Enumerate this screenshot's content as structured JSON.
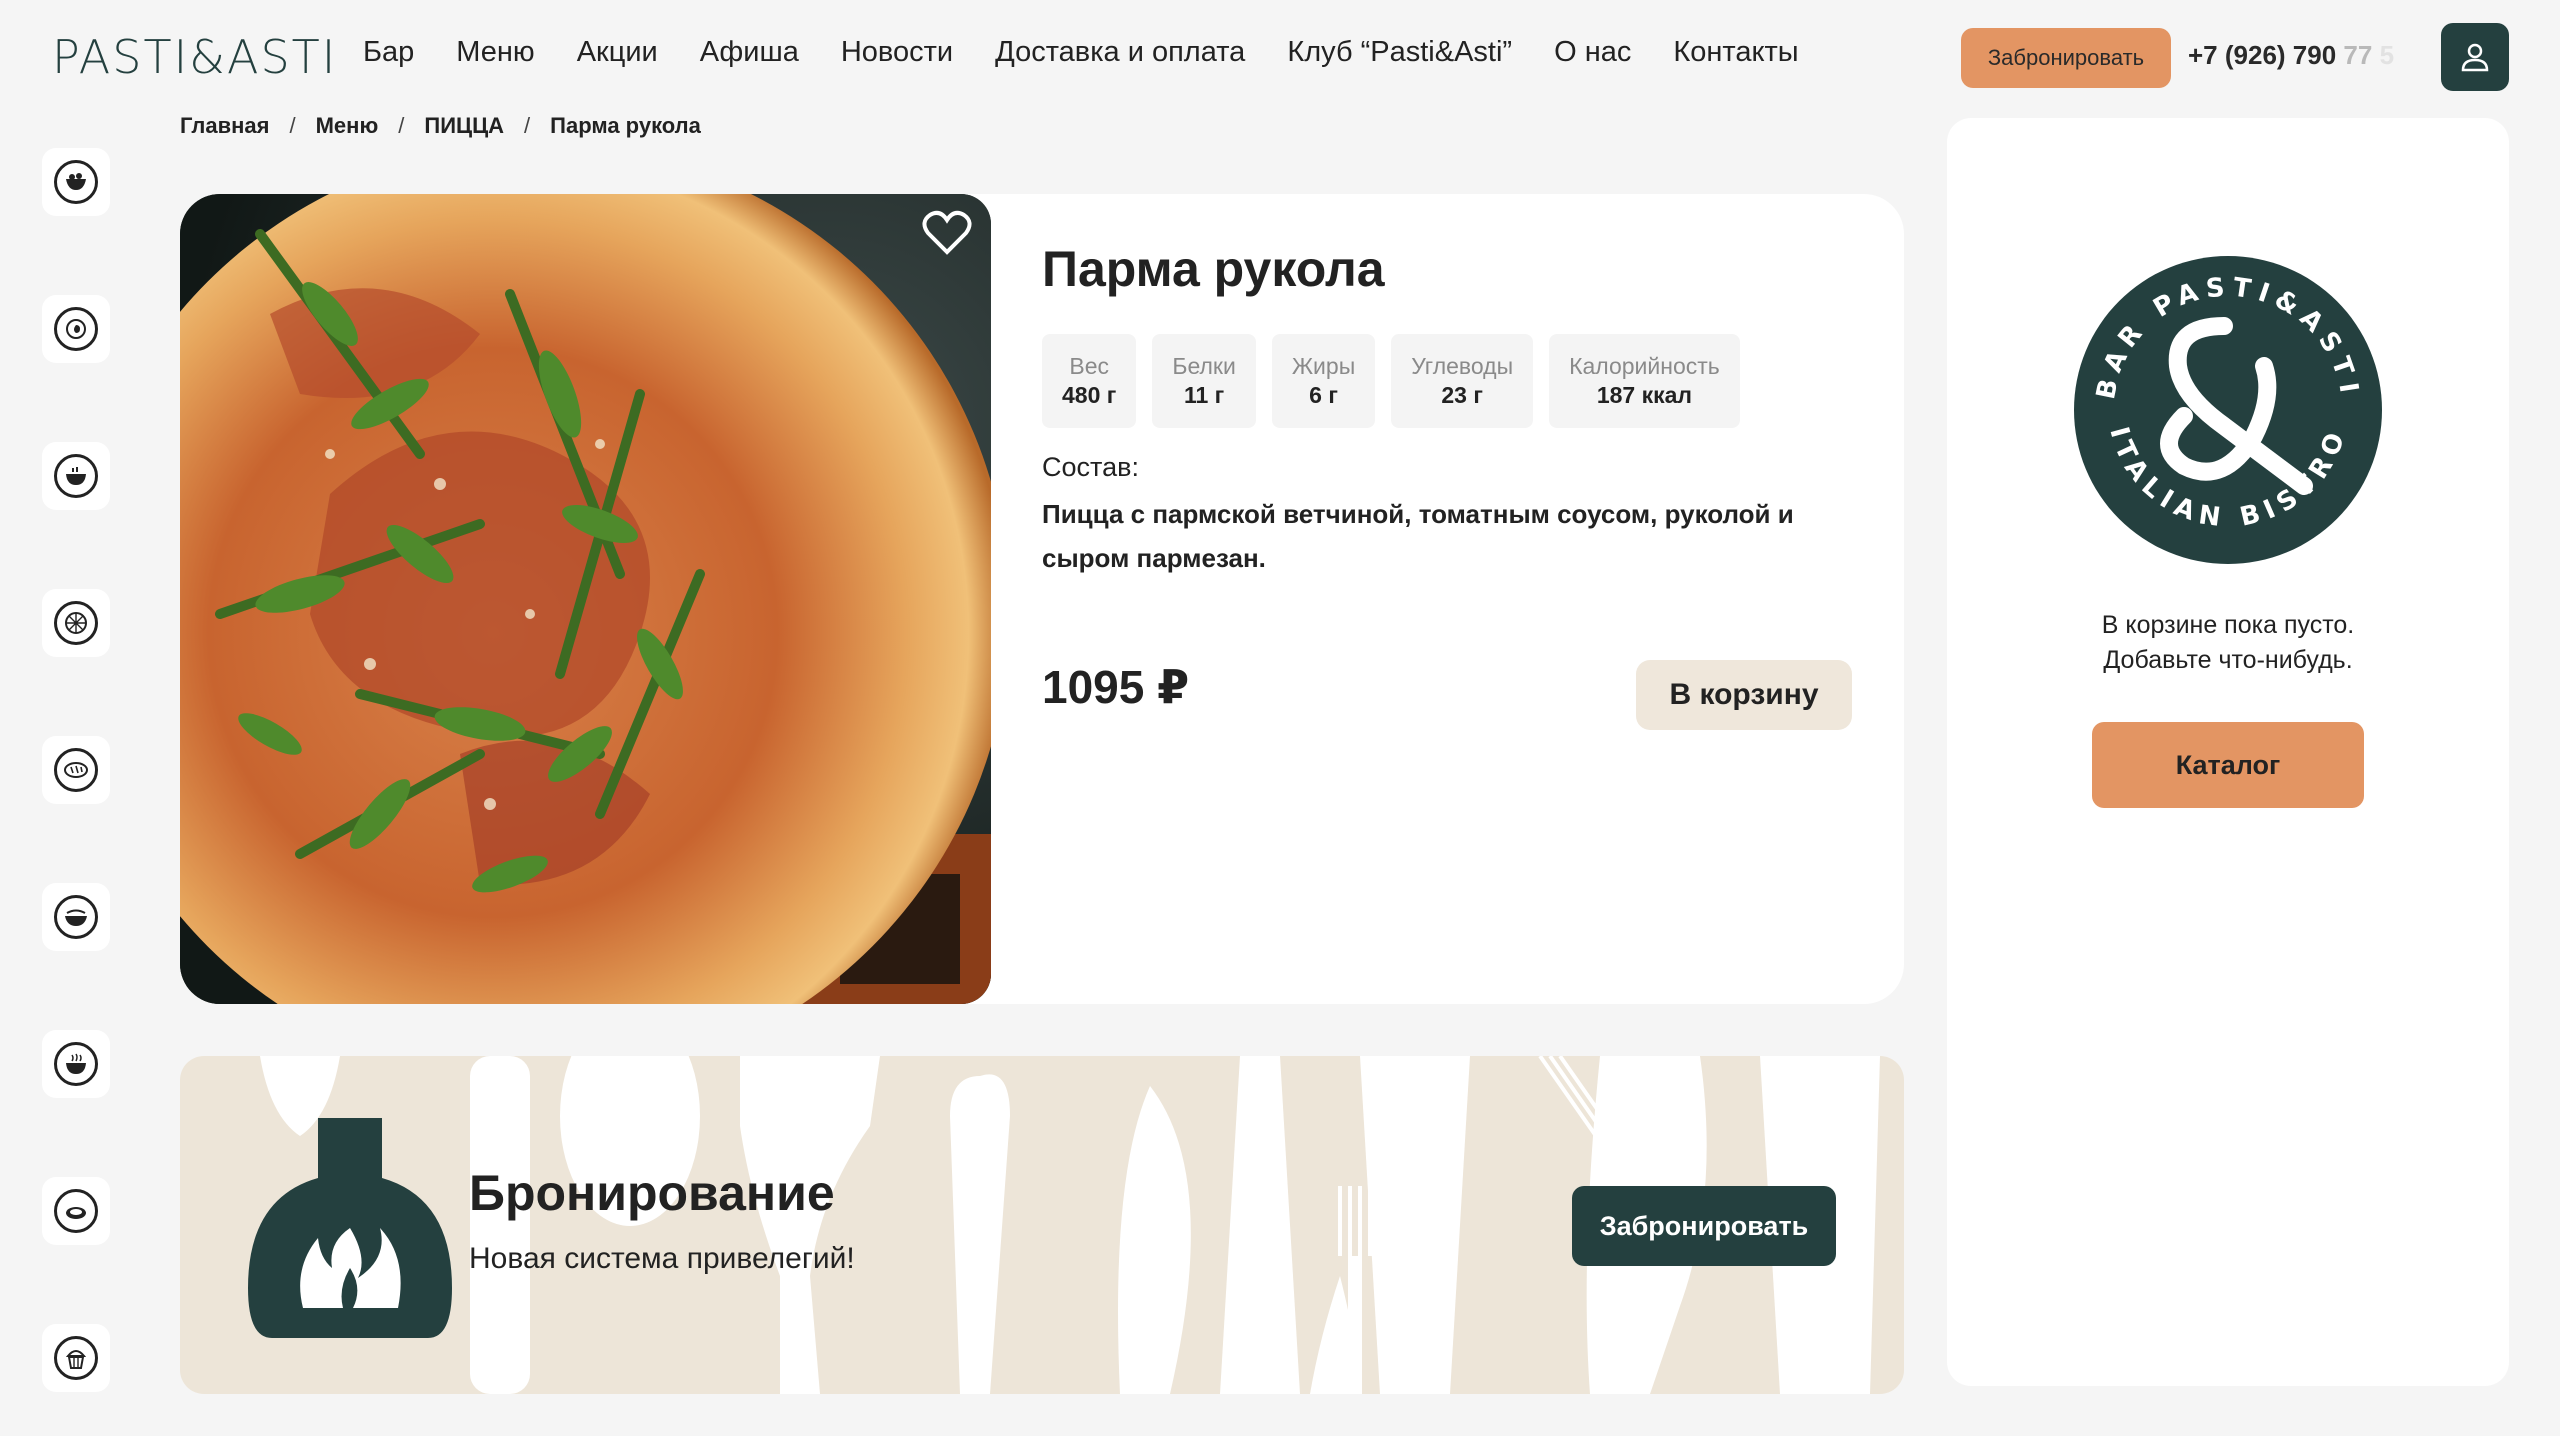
{
  "header": {
    "logo": "PASTI&ASTI",
    "nav": [
      "Бар",
      "Меню",
      "Акции",
      "Афиша",
      "Новости",
      "Доставка и оплата",
      "Клуб “Pasti&Asti”",
      "О нас",
      "Контакты"
    ],
    "book_label": "Забронировать",
    "phone_main": "+7 (926) 790",
    "phone_fade": "77",
    "phone_fade2": "5"
  },
  "breadcrumb": [
    "Главная",
    "Меню",
    "ПИЦЦА",
    "Парма рукола"
  ],
  "product": {
    "title": "Парма рукола",
    "nutrition": [
      {
        "label": "Вес",
        "value": "480 г"
      },
      {
        "label": "Белки",
        "value": "11 г"
      },
      {
        "label": "Жиры",
        "value": "6 г"
      },
      {
        "label": "Углеводы",
        "value": "23 г"
      },
      {
        "label": "Калорийность",
        "value": "187 ккал"
      }
    ],
    "composition_label": "Состав:",
    "composition": "Пицца с пармской ветчиной, томатным соусом, руколой и сыром пармезан.",
    "price": "1095 ₽",
    "cart_label": "В корзину"
  },
  "booking": {
    "title": "Бронирование",
    "subtitle": "Новая система привелегий!",
    "button": "Забронировать"
  },
  "cart": {
    "logo_top": "BAR PASTI&ASTI",
    "logo_bottom": "ITALIAN BISTRO",
    "empty_line1": "В корзине пока пусто.",
    "empty_line2": "Добавьте что-нибудь.",
    "catalog": "Каталог"
  },
  "colors": {
    "brand": "#24403f",
    "accent": "#e39563",
    "beige": "#ede5d8"
  }
}
